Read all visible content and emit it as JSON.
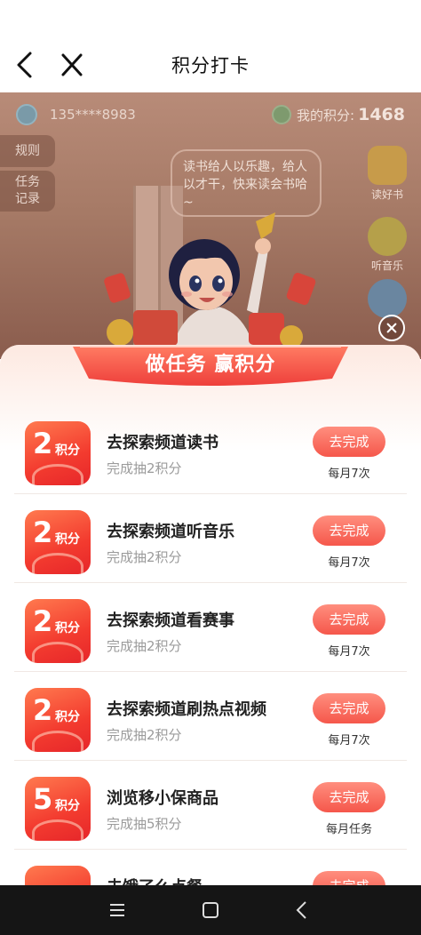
{
  "header": {
    "title": "积分打卡"
  },
  "hero": {
    "phone": "135****8983",
    "points_label": "我的积分:",
    "points_value": "1468",
    "rule_tab": "规则",
    "record_tab_line1": "任务",
    "record_tab_line2": "记录",
    "bubble_text": "读书给人以乐趣，给人以才干，快来读会书哈~",
    "right_buttons": [
      {
        "label": "读好书",
        "icon": "book-icon"
      },
      {
        "label": "听音乐",
        "icon": "music-icon"
      },
      {
        "label": "",
        "icon": "game-icon"
      }
    ]
  },
  "panel": {
    "banner_title": "做任务 赢积分",
    "tasks": [
      {
        "points": "2",
        "unit": "积分",
        "name": "去探索频道读书",
        "sub": "完成抽2积分",
        "button": "去完成",
        "freq": "每月7次"
      },
      {
        "points": "2",
        "unit": "积分",
        "name": "去探索频道听音乐",
        "sub": "完成抽2积分",
        "button": "去完成",
        "freq": "每月7次"
      },
      {
        "points": "2",
        "unit": "积分",
        "name": "去探索频道看赛事",
        "sub": "完成抽2积分",
        "button": "去完成",
        "freq": "每月7次"
      },
      {
        "points": "2",
        "unit": "积分",
        "name": "去探索频道刷热点视频",
        "sub": "完成抽2积分",
        "button": "去完成",
        "freq": "每月7次"
      },
      {
        "points": "5",
        "unit": "积分",
        "name": "浏览移小保商品",
        "sub": "完成抽5积分",
        "button": "去完成",
        "freq": "每月任务"
      },
      {
        "points": "",
        "unit": "",
        "name": "去饿了么点餐",
        "sub": "",
        "button": "去完成",
        "freq": ""
      }
    ]
  },
  "colors": {
    "accent": "#f5574b",
    "badge": "#f33b2f",
    "banner": "#f04a43"
  }
}
